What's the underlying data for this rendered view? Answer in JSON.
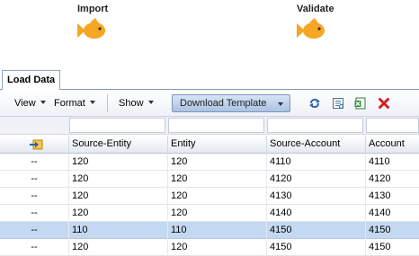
{
  "steps": [
    {
      "label": "Import",
      "icon": "fish-icon",
      "color": "#f5a623"
    },
    {
      "label": "Validate",
      "icon": "fish-icon",
      "color": "#f5a623"
    }
  ],
  "tab": {
    "label": "Load Data"
  },
  "toolbar": {
    "view": "View",
    "format": "Format",
    "show": "Show",
    "download_template": "Download Template",
    "icons": [
      "refresh-icon",
      "report-icon",
      "excel-export-icon",
      "delete-icon"
    ]
  },
  "table": {
    "columns": [
      "",
      "Source-Entity",
      "Entity",
      "Source-Account",
      "Account"
    ],
    "rows": [
      {
        "status": "--",
        "source_entity": "120",
        "entity": "120",
        "source_account": "4110",
        "account": "4110",
        "selected": false
      },
      {
        "status": "--",
        "source_entity": "120",
        "entity": "120",
        "source_account": "4120",
        "account": "4120",
        "selected": false
      },
      {
        "status": "--",
        "source_entity": "120",
        "entity": "120",
        "source_account": "4130",
        "account": "4130",
        "selected": false
      },
      {
        "status": "--",
        "source_entity": "120",
        "entity": "120",
        "source_account": "4140",
        "account": "4140",
        "selected": false
      },
      {
        "status": "--",
        "source_entity": "110",
        "entity": "110",
        "source_account": "4150",
        "account": "4150",
        "selected": true
      },
      {
        "status": "--",
        "source_entity": "120",
        "entity": "120",
        "source_account": "4150",
        "account": "4150",
        "selected": false
      }
    ]
  },
  "colors": {
    "selected_row": "#c4d9f1",
    "accent": "#f5a623"
  }
}
